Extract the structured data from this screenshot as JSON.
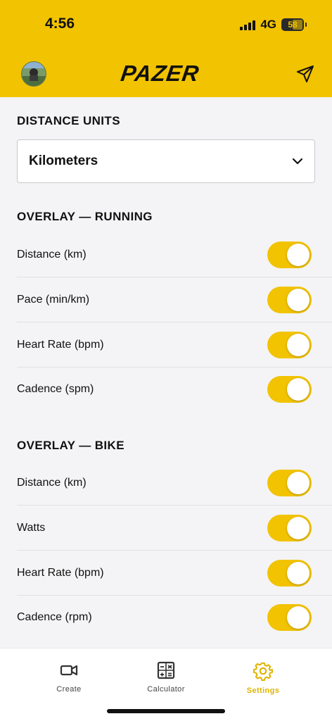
{
  "status_bar": {
    "time": "4:56",
    "network": "4G",
    "battery": "58"
  },
  "header": {
    "logo_text": "PAZER",
    "avatar": "profile-avatar",
    "action_icon": "send-icon"
  },
  "distance_units": {
    "title": "DISTANCE UNITS",
    "selected": "Kilometers"
  },
  "overlay_running": {
    "title": "OVERLAY — RUNNING",
    "items": [
      {
        "label": "Distance  (km)",
        "enabled": true
      },
      {
        "label": "Pace  (min/km)",
        "enabled": true
      },
      {
        "label": "Heart Rate  (bpm)",
        "enabled": true
      },
      {
        "label": "Cadence  (spm)",
        "enabled": true
      }
    ]
  },
  "overlay_bike": {
    "title": "OVERLAY — BIKE",
    "items": [
      {
        "label": "Distance  (km)",
        "enabled": true
      },
      {
        "label": "Watts",
        "enabled": true
      },
      {
        "label": "Heart Rate  (bpm)",
        "enabled": true
      },
      {
        "label": "Cadence  (rpm)",
        "enabled": true
      }
    ]
  },
  "tabbar": {
    "tabs": [
      {
        "label": "Create",
        "icon": "video-camera-icon",
        "active": false
      },
      {
        "label": "Calculator",
        "icon": "calculator-icon",
        "active": false
      },
      {
        "label": "Settings",
        "icon": "gear-icon",
        "active": true
      }
    ]
  },
  "colors": {
    "accent": "#f2c300",
    "background": "#f4f4f6",
    "active_tab": "#e0b400"
  }
}
